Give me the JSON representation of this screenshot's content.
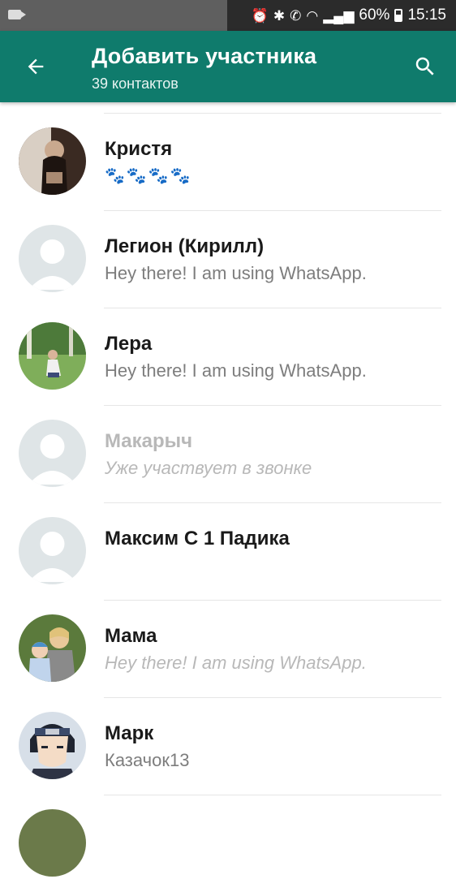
{
  "status_bar": {
    "battery": "60%",
    "time": "15:15"
  },
  "header": {
    "title": "Добавить участника",
    "subtitle": "39 контактов",
    "back_icon": "arrow-back-icon",
    "search_icon": "search-icon"
  },
  "contacts": [
    {
      "name": "Кристя",
      "status": "🐾🐾🐾🐾"
    },
    {
      "name": "Легион (Кирилл)",
      "status": "Hey there! I am using WhatsApp."
    },
    {
      "name": "Лера",
      "status": "Hey there! I am using WhatsApp."
    },
    {
      "name": "Макарыч",
      "status": "Уже участвует в звонке"
    },
    {
      "name": "Максим С 1 Падика",
      "status": ""
    },
    {
      "name": "Мама",
      "status": "Hey there! I am using WhatsApp."
    },
    {
      "name": "Марк",
      "status": "Казачок13"
    }
  ],
  "colors": {
    "appbar": "#0f7b6c",
    "placeholder_avatar": "#dfe5e7"
  }
}
